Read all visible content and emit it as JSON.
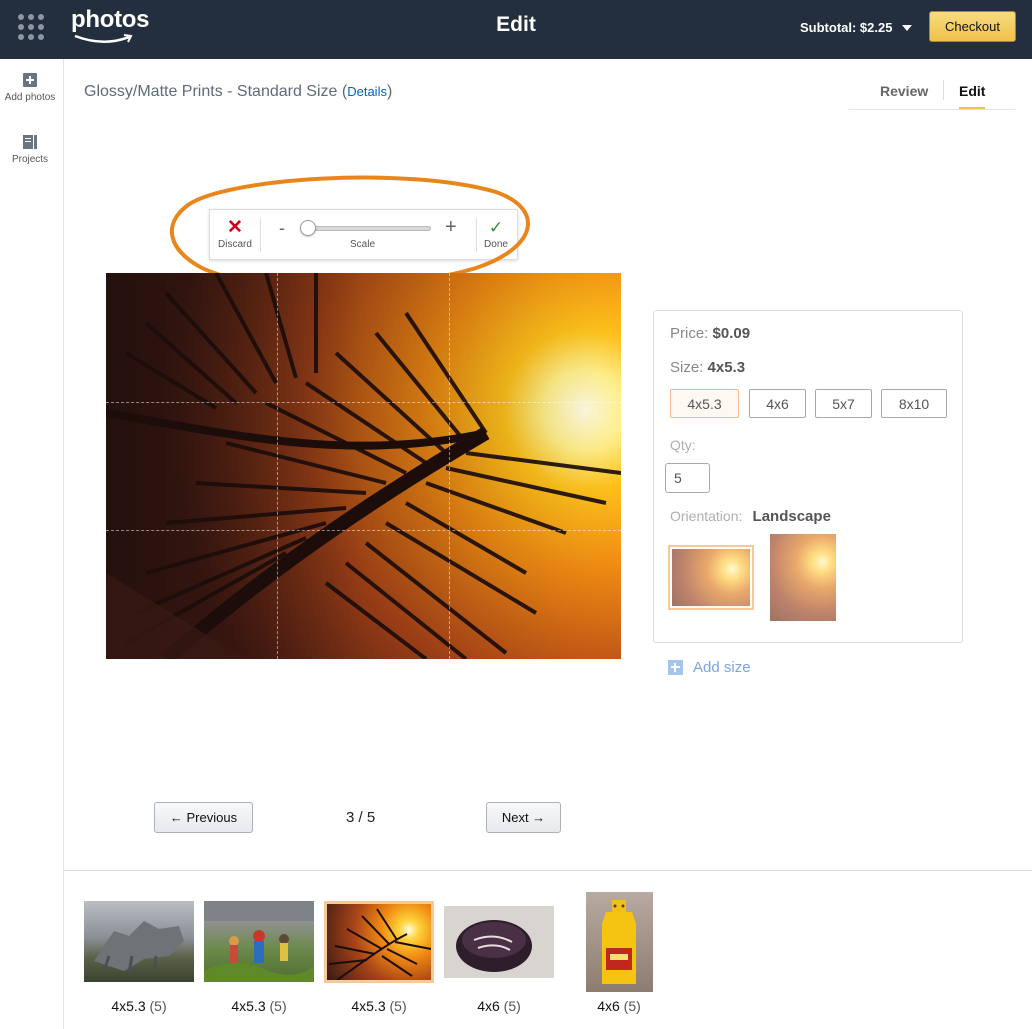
{
  "header": {
    "logo_text": "photos",
    "title": "Edit",
    "subtotal": "Subtotal: $2.25",
    "checkout_label": "Checkout"
  },
  "sidebar": {
    "items": [
      {
        "label": "Add photos",
        "icon": "add-photos-icon"
      },
      {
        "label": "Projects",
        "icon": "projects-icon"
      }
    ]
  },
  "product": {
    "title": "Glossy/Matte Prints - Standard Size",
    "details_open": "(",
    "details_link": "Details",
    "details_close": ")"
  },
  "tabs": [
    {
      "label": "Review",
      "active": false
    },
    {
      "label": "Edit",
      "active": true
    }
  ],
  "toolbar": {
    "discard_label": "Discard",
    "minus_label": "-",
    "plus_label": "+",
    "scale_label": "Scale",
    "done_label": "Done",
    "scale_value": 0
  },
  "options": {
    "price_label": "Price:",
    "price_value": "$0.09",
    "size_label": "Size:",
    "size_value": "4x5.3",
    "sizes": [
      "4x5.3",
      "4x6",
      "5x7",
      "8x10"
    ],
    "selected_size": "4x5.3",
    "qty_label": "Qty:",
    "qty_value": "5",
    "orientation_label": "Orientation:",
    "orientation_value": "Landscape",
    "add_size_label": "Add size"
  },
  "pagination": {
    "previous_label": "← Previous",
    "page_indicator": "3 / 5",
    "next_label": "Next →"
  },
  "filmstrip": [
    {
      "size": "4x5.3",
      "count": "(5)",
      "subject": "stone animal sculpture"
    },
    {
      "size": "4x5.3",
      "count": "(5)",
      "subject": "street market"
    },
    {
      "size": "4x5.3",
      "count": "(5)",
      "subject": "palm sunset",
      "selected": true
    },
    {
      "size": "4x6",
      "count": "(5)",
      "subject": "cake"
    },
    {
      "size": "4x6",
      "count": "(5)",
      "subject": "mustard bottle"
    }
  ],
  "colors": {
    "topbar": "#232f3e",
    "checkout": "#f0c14b",
    "annotation": "#e8861c",
    "link": "#0066c0"
  }
}
